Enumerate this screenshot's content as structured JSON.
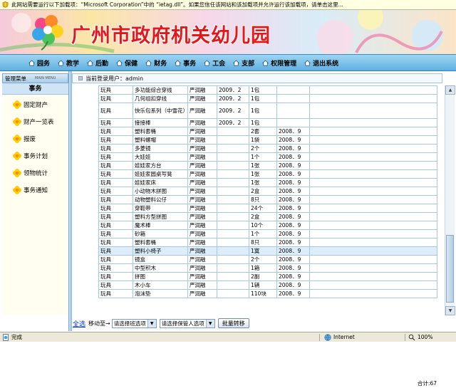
{
  "infobar": {
    "text": "此网站需要运行以下加载项：“Microsoft Corporation”中的 “ietag.dll”。如果您信任该网站和该加载项并允许运行该加载项，请单击这里..."
  },
  "banner": {
    "title": "广州市政府机关幼儿园"
  },
  "nav": [
    {
      "label": "园务"
    },
    {
      "label": "教学"
    },
    {
      "label": "后勤"
    },
    {
      "label": "保健"
    },
    {
      "label": "财务"
    },
    {
      "label": "事务"
    },
    {
      "label": "工会"
    },
    {
      "label": "支部"
    },
    {
      "label": "权限管理"
    },
    {
      "label": "退出系统"
    }
  ],
  "sidebar": {
    "header": "管理菜单",
    "header_en": "MAIN MENU",
    "section": "事务",
    "items": [
      {
        "label": "固定财产"
      },
      {
        "label": "财产一览表"
      },
      {
        "label": "报废"
      },
      {
        "label": "事务计划"
      },
      {
        "label": "领物统计"
      },
      {
        "label": "事务通知"
      }
    ]
  },
  "userbar": {
    "text": "当前登录用户：admin"
  },
  "table": {
    "rows": [
      [
        "玩具",
        "多功能综合穿线",
        "严润融",
        "2009．2",
        "1包",
        "",
        ""
      ],
      [
        "玩具",
        "几何组扣穿线",
        "严润融",
        "2009．2",
        "1包",
        "",
        ""
      ],
      [
        "玩具",
        "快乐包系列（中雪花）",
        "严润融",
        "2009．2",
        "1包",
        "",
        ""
      ],
      [
        "玩具",
        "接接棒",
        "严润融",
        "2009．2",
        "1包",
        "",
        ""
      ],
      [
        "玩具",
        "塑料套桶",
        "严润融",
        "",
        "2套",
        "2008．9",
        ""
      ],
      [
        "玩具",
        "塑料螺帽",
        "严润融",
        "",
        "1袋",
        "2008．9",
        ""
      ],
      [
        "玩具",
        "多菱镜",
        "严润融",
        "",
        "2个",
        "2008．9",
        ""
      ],
      [
        "玩具",
        "大娃娃",
        "严润融",
        "",
        "1个",
        "2008．9",
        ""
      ],
      [
        "玩具",
        "娃娃家方台",
        "严润融",
        "",
        "1张",
        "2008．9",
        ""
      ],
      [
        "玩具",
        "娃娃家圆桌写凳",
        "严润融",
        "",
        "1张",
        "2008．9",
        ""
      ],
      [
        "玩具",
        "娃娃家床",
        "严润融",
        "",
        "1张",
        "2008．9",
        ""
      ],
      [
        "玩具",
        "小动物木拼图",
        "严润融",
        "",
        "2盒",
        "2008．9",
        ""
      ],
      [
        "玩具",
        "动物塑料公仔",
        "严润融",
        "",
        "8只",
        "2008．9",
        ""
      ],
      [
        "玩具",
        "穿鞋带",
        "严润融",
        "",
        "24个",
        "2008．9",
        ""
      ],
      [
        "玩具",
        "塑料方型拼图",
        "严润融",
        "",
        "2盒",
        "2008．9",
        ""
      ],
      [
        "玩具",
        "魔术棒",
        "严润融",
        "",
        "10个",
        "2008．9",
        ""
      ],
      [
        "玩具",
        "砂箱",
        "严润融",
        "",
        "1个",
        "2008．9",
        ""
      ],
      [
        "玩具",
        "塑料套桶",
        "严润融",
        "",
        "8只",
        "2008．9",
        ""
      ],
      [
        "玩具",
        "塑料小椅子",
        "严润融",
        "",
        "1寞",
        "2008．9",
        ""
      ],
      [
        "玩具",
        "镜盒",
        "严润融",
        "",
        "2个",
        "2008．9",
        ""
      ],
      [
        "玩具",
        "中型积木",
        "严润融",
        "",
        "1箱",
        "2008．9",
        ""
      ],
      [
        "玩具",
        "拼图",
        "严润融",
        "",
        "2副",
        "2008．9",
        ""
      ],
      [
        "玩具",
        "木小车",
        "严润融",
        "",
        "1辆",
        "2008．9",
        ""
      ],
      [
        "玩具",
        "泡沫垫",
        "严润融",
        "",
        "110块",
        "2008．9",
        ""
      ]
    ],
    "selected_row": 18,
    "total": "合计:67"
  },
  "bottom": {
    "select_all": "全选",
    "move_to": "移动至→",
    "class_select": "请选择班选项",
    "keeper_select": "请选择保管人选项",
    "batch_button": "批量转移"
  },
  "status": {
    "done": "完成",
    "zone": "Internet",
    "zoom": "100%"
  },
  "colors": {
    "title_red": "#e4181a",
    "nav_blue": "#5fb1e1",
    "link_blue": "#0033cc"
  }
}
